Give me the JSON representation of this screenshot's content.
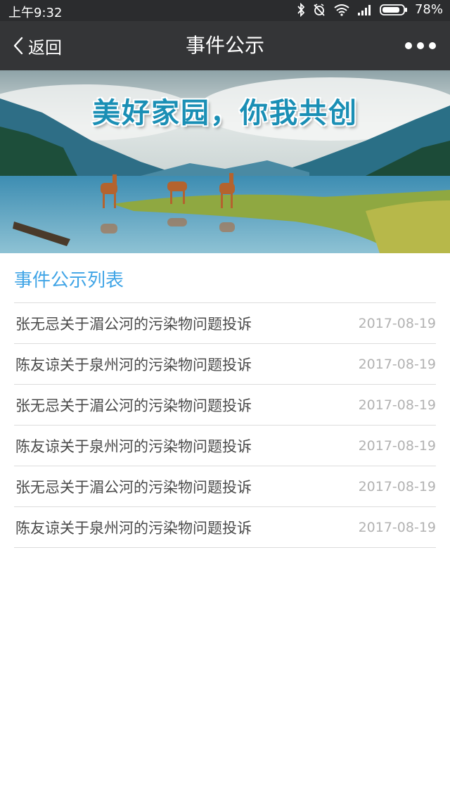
{
  "status_bar": {
    "time": "上午9:32",
    "battery": "78%",
    "icons": [
      "bluetooth-icon",
      "alarm-off-icon",
      "wifi-icon",
      "signal-icon",
      "battery-icon"
    ]
  },
  "navbar": {
    "back_label": "返回",
    "title": "事件公示",
    "more_icon": "more-dots-icon"
  },
  "banner": {
    "slogan": "美好家园，你我共创"
  },
  "list": {
    "title": "事件公示列表",
    "items": [
      {
        "title": "张无忌关于湄公河的污染物问题投诉",
        "date": "2017-08-19"
      },
      {
        "title": "陈友谅关于泉州河的污染物问题投诉",
        "date": "2017-08-19"
      },
      {
        "title": "张无忌关于湄公河的污染物问题投诉",
        "date": "2017-08-19"
      },
      {
        "title": "陈友谅关于泉州河的污染物问题投诉",
        "date": "2017-08-19"
      },
      {
        "title": "张无忌关于湄公河的污染物问题投诉",
        "date": "2017-08-19"
      },
      {
        "title": "陈友谅关于泉州河的污染物问题投诉",
        "date": "2017-08-19"
      }
    ]
  },
  "colors": {
    "statusbar_bg": "#2b2c2e",
    "navbar_bg": "#343537",
    "accent": "#3fa4e6",
    "date_text": "#b2b2b2"
  }
}
